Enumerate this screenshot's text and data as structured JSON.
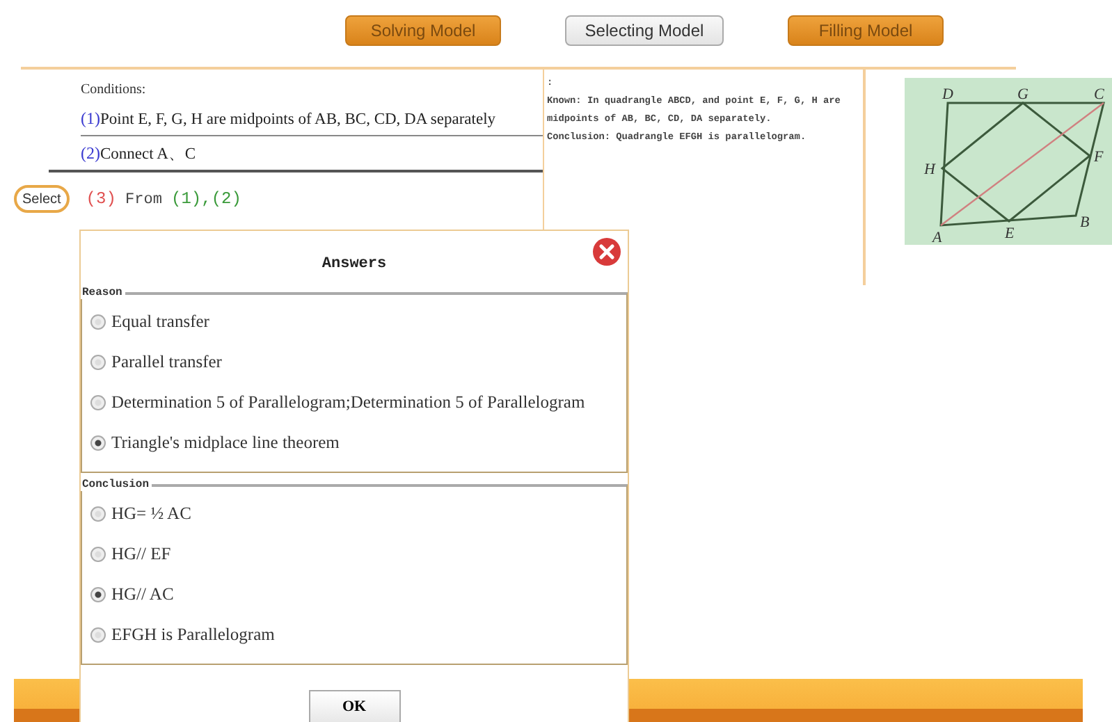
{
  "modes": [
    {
      "label": "Solving Model",
      "selected": false
    },
    {
      "label": "Selecting Model",
      "selected": true
    },
    {
      "label": "Filling Model",
      "selected": false
    }
  ],
  "conditions": {
    "title": "Conditions:",
    "items": [
      {
        "number": "(1)",
        "text": "Point E, F, G, H are midpoints of AB, BC, CD, DA separately"
      },
      {
        "number": "(2)",
        "text": "Connect A、C"
      }
    ]
  },
  "step": {
    "button": "Select",
    "number": "(3)",
    "text": "From",
    "refs": "(1),(2)"
  },
  "known": {
    "mark": ":",
    "paragraphs": [
      "Known: In quadrangle ABCD, and point E, F, G, H are midpoints of AB, BC, CD, DA separately.",
      "Conclusion: Quadrangle EFGH is parallelogram."
    ]
  },
  "diagram": {
    "labels": [
      "D",
      "G",
      "C",
      "H",
      "F",
      "A",
      "E",
      "B"
    ]
  },
  "dialog": {
    "title": "Answers",
    "groups": [
      {
        "legend": "Reason",
        "options": [
          {
            "label": "Equal transfer",
            "selected": false
          },
          {
            "label": "Parallel transfer",
            "selected": false
          },
          {
            "label": "Determination 5 of Parallelogram;Determination 5 of Parallelogram",
            "selected": false
          },
          {
            "label": "Triangle's midplace line theorem",
            "selected": true
          }
        ]
      },
      {
        "legend": "Conclusion",
        "options": [
          {
            "label": "HG= ½ AC",
            "selected": false
          },
          {
            "label": "HG// EF",
            "selected": false
          },
          {
            "label": "HG// AC",
            "selected": true
          },
          {
            "label": "EFGH is Parallelogram",
            "selected": false
          }
        ]
      }
    ],
    "ok": "OK"
  }
}
